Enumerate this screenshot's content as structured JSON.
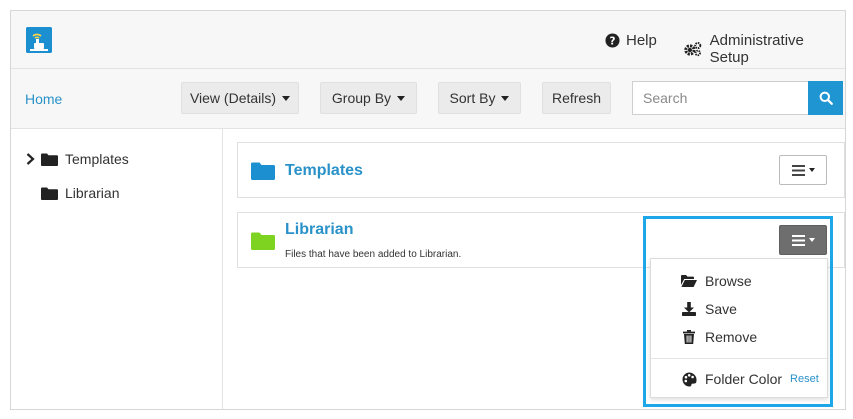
{
  "header": {
    "help_label": "Help",
    "admin_label": "Administrative Setup"
  },
  "toolbar": {
    "home_label": "Home",
    "view_label": "View (Details)",
    "group_label": "Group By",
    "sort_label": "Sort By",
    "refresh_label": "Refresh",
    "search_placeholder": "Search"
  },
  "sidebar": {
    "items": [
      {
        "label": "Templates",
        "expandable": true
      },
      {
        "label": "Librarian",
        "expandable": false
      }
    ]
  },
  "folders": [
    {
      "name": "Templates",
      "description": "",
      "color": "#1b8fd0"
    },
    {
      "name": "Librarian",
      "description": "Files that have been added to Librarian.",
      "color": "#7ed321"
    }
  ],
  "menu": {
    "items": [
      {
        "label": "Browse",
        "icon": "folder-open-icon"
      },
      {
        "label": "Save",
        "icon": "download-icon"
      },
      {
        "label": "Remove",
        "icon": "trash-icon"
      },
      {
        "label": "Folder Color",
        "icon": "palette-icon"
      }
    ],
    "reset_label": "Reset"
  },
  "colors": {
    "accent": "#2a92c9",
    "search_button": "#1f95d2",
    "highlight": "#1ea7e8",
    "menu_button_active": "#6e6e6e"
  }
}
